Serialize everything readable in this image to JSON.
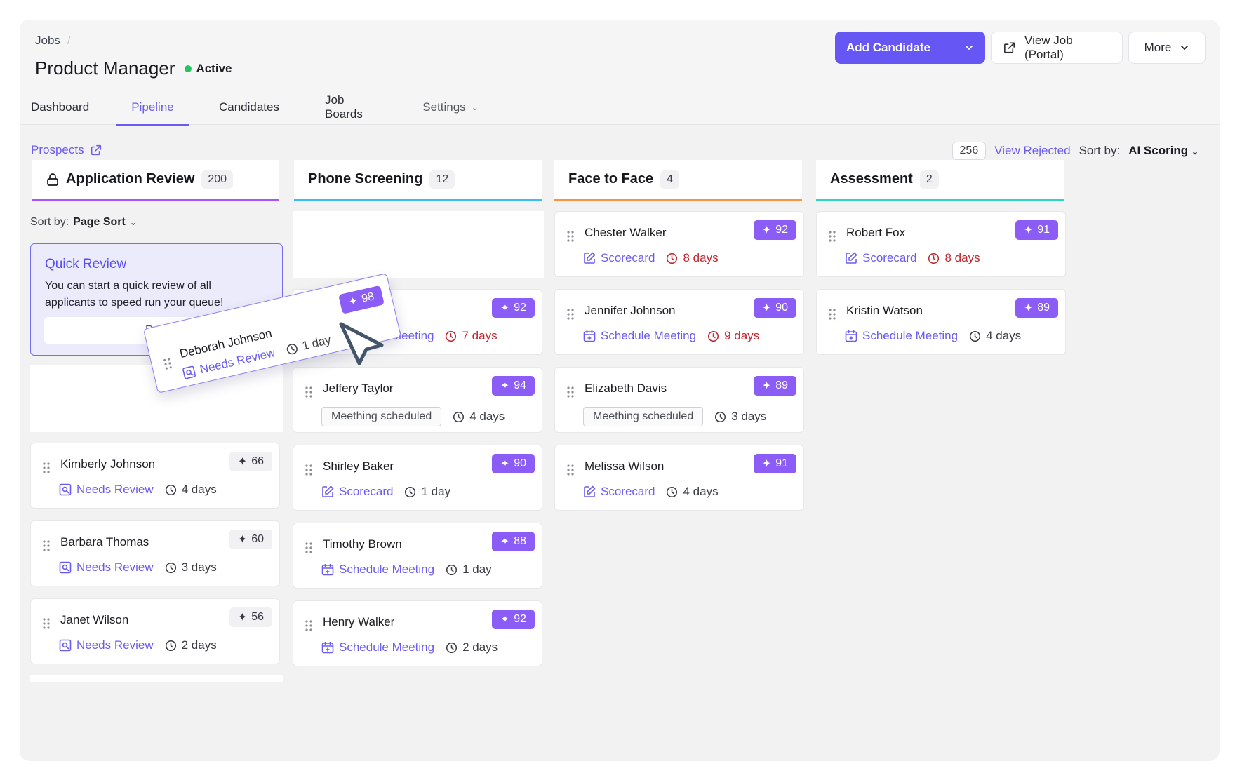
{
  "breadcrumb": {
    "root": "Jobs"
  },
  "job": {
    "title": "Product Manager",
    "status": "Active"
  },
  "tabs": [
    {
      "label": "Dashboard"
    },
    {
      "label": "Pipeline"
    },
    {
      "label": "Candidates"
    },
    {
      "label": "Job Boards"
    },
    {
      "label": "Settings"
    }
  ],
  "actions": {
    "add_candidate": "Add Candidate",
    "view_job": "View Job (Portal)",
    "more": "More"
  },
  "toolbar": {
    "prospects": "Prospects",
    "rejected_count": "256",
    "view_rejected": "View Rejected",
    "sort_label": "Sort by:",
    "sort_value": "AI Scoring"
  },
  "colors": {
    "accent": "#6657f5",
    "score": "#8b5cf6",
    "late": "#c0262d",
    "app_review": "#a855f7",
    "phone": "#38bdf8",
    "face": "#fb923c",
    "assessment": "#2dd4bf"
  },
  "columns": [
    {
      "name": "Application Review",
      "count": "200",
      "sort_label": "Sort by:",
      "sort_value": "Page Sort"
    },
    {
      "name": "Phone Screening",
      "count": "12"
    },
    {
      "name": "Face to Face",
      "count": "4"
    },
    {
      "name": "Assessment",
      "count": "2"
    }
  ],
  "quick_review": {
    "title": "Quick Review",
    "description": "You can start a quick review of all applicants to speed run your queue!",
    "button": "Revi"
  },
  "dragging": {
    "name": "Deborah Johnson",
    "score": "98",
    "action": "Needs Review",
    "time": "1 day"
  },
  "cards": {
    "app": [
      {
        "name": "Kimberly Johnson",
        "score": "66",
        "action": "Needs Review",
        "time": "4 days"
      },
      {
        "name": "Barbara Thomas",
        "score": "60",
        "action": "Needs Review",
        "time": "3 days"
      },
      {
        "name": "Janet Wilson",
        "score": "56",
        "action": "Needs Review",
        "time": "2 days"
      }
    ],
    "phone": [
      {
        "score": "92",
        "action": "Meeting",
        "time": "7 days"
      },
      {
        "name": "Jeffery Taylor",
        "score": "94",
        "action": "Meething scheduled",
        "time": "4 days"
      },
      {
        "name": "Shirley Baker",
        "score": "90",
        "action": "Scorecard",
        "time": "1 day"
      },
      {
        "name": "Timothy Brown",
        "score": "88",
        "action": "Schedule Meeting",
        "time": "1 day"
      },
      {
        "name": "Henry Walker",
        "score": "92",
        "action": "Schedule Meeting",
        "time": "2 days"
      }
    ],
    "face": [
      {
        "name": "Chester Walker",
        "score": "92",
        "action": "Scorecard",
        "time": "8 days"
      },
      {
        "name": "Jennifer Johnson",
        "score": "90",
        "action": "Schedule Meeting",
        "time": "9 days"
      },
      {
        "name": "Elizabeth Davis",
        "score": "89",
        "action": "Meething scheduled",
        "time": "3 days"
      },
      {
        "name": "Melissa Wilson",
        "score": "91",
        "action": "Scorecard",
        "time": "4 days"
      }
    ],
    "assess": [
      {
        "name": "Robert Fox",
        "score": "91",
        "action": "Scorecard",
        "time": "8 days"
      },
      {
        "name": "Kristin Watson",
        "score": "89",
        "action": "Schedule Meeting",
        "time": "4 days"
      }
    ]
  }
}
